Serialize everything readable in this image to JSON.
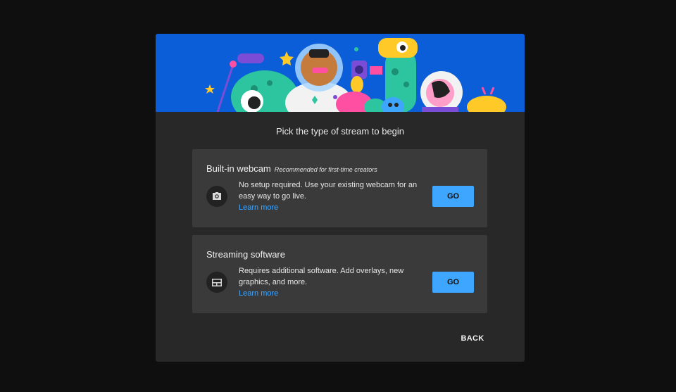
{
  "dialog": {
    "heading": "Pick the type of stream to begin",
    "back_label": "BACK"
  },
  "options": [
    {
      "title": "Built-in webcam",
      "subtitle": "Recommended for first-time creators",
      "description": "No setup required. Use your existing webcam for an easy way to go live.",
      "link": "Learn more",
      "button": "GO",
      "icon": "camera-icon"
    },
    {
      "title": "Streaming software",
      "subtitle": "",
      "description": "Requires additional software. Add overlays, new graphics, and more.",
      "link": "Learn more",
      "button": "GO",
      "icon": "layout-icon"
    }
  ],
  "colors": {
    "page_background": "#0f0f0f",
    "dialog_background": "#282828",
    "card_background": "#3a3a3a",
    "banner_blue": "#0b5ed7",
    "accent_blue": "#3ea6ff"
  }
}
